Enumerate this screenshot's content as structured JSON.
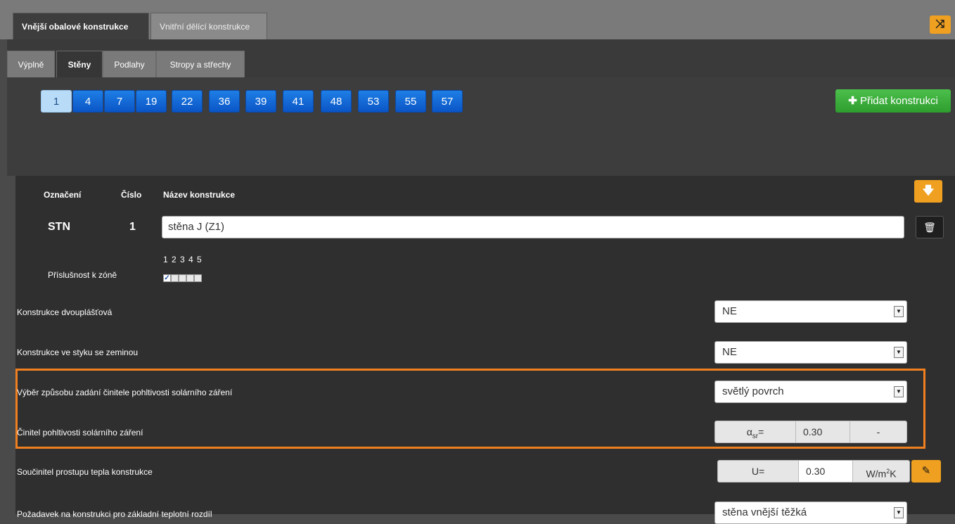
{
  "top_tabs": [
    "Vnější obalové konstrukce",
    "Vnitřní dělící konstrukce"
  ],
  "shuffle_icon": "shuffle-icon",
  "sub_tabs": [
    "Výplně",
    "Stěny",
    "Podlahy",
    "Stropy a střechy"
  ],
  "numbers": [
    "1",
    "4",
    "7",
    "19",
    "22",
    "36",
    "39",
    "41",
    "48",
    "53",
    "55",
    "57"
  ],
  "active_number": "1",
  "add_button": "Přidat konstrukci",
  "headers": {
    "oznaceni": "Označení",
    "cislo": "Číslo",
    "nazev": "Název konstrukce"
  },
  "construction": {
    "oznaceni": "STN",
    "cislo": "1",
    "nazev": "stěna J (Z1)"
  },
  "zone": {
    "label": "Příslušnost k zóně",
    "numbers": "1 2 3 4 5",
    "checked": [
      true,
      false,
      false,
      false,
      false
    ]
  },
  "rows": {
    "dvouplastova": {
      "label": "Konstrukce dvouplášťová",
      "value": "NE"
    },
    "styk_zeminou": {
      "label": "Konstrukce ve styku se zeminou",
      "value": "NE"
    },
    "vyber_zpusobu": {
      "label": "Výběr způsobu zadání činitele pohltivosti solárního záření",
      "value": "světlý povrch"
    },
    "cinitel": {
      "label": "Činitel pohltivosti solárního záření",
      "symbol": "α",
      "subscript": "sr",
      "eq": "=",
      "value": "0.30",
      "unit": "-"
    },
    "soucinitel": {
      "label": "Součinitel prostupu tepla konstrukce",
      "symbol": "U=",
      "value": "0.30",
      "unit": "W/m",
      "unit_sup": "2",
      "unit_end": "K"
    },
    "pozadavek": {
      "label": "Požadavek na konstrukci pro základní teplotní rozdíl",
      "value": "stěna vnější těžká"
    }
  },
  "colors": {
    "accent_orange": "#f0a020",
    "highlight": "#f07f1f",
    "blue_button": "#0b55c6",
    "green_button": "#2e9e2e"
  }
}
